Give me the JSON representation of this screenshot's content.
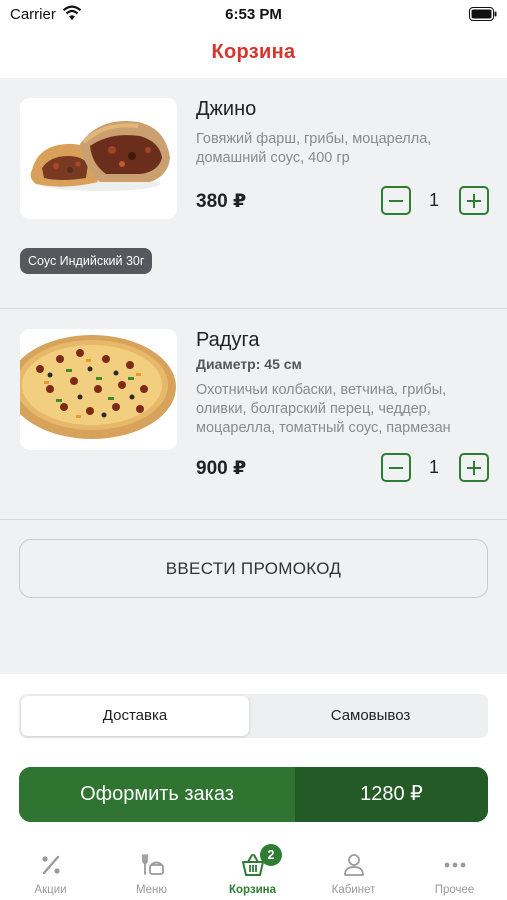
{
  "status_bar": {
    "carrier": "Carrier",
    "time": "6:53 PM"
  },
  "header": {
    "title": "Корзина"
  },
  "cart": {
    "items": [
      {
        "name": "Джино",
        "description": "Говяжий фарш, грибы, моцарелла, домашний соус, 400 гр",
        "price": "380 ₽",
        "quantity": "1",
        "addon": "Соус Индийский 30г"
      },
      {
        "name": "Радуга",
        "meta": "Диаметр: 45 см",
        "description": "Охотничьи колбаски, ветчина, грибы, оливки, болгарский перец, чеддер, моцарелла, томатный соус, пармезан",
        "price": "900 ₽",
        "quantity": "1"
      }
    ],
    "promo_label": "ВВЕСТИ ПРОМОКОД"
  },
  "delivery": {
    "options": [
      "Доставка",
      "Самовывоз"
    ],
    "selected": "Доставка"
  },
  "checkout": {
    "label": "Оформить заказ",
    "total": "1280 ₽"
  },
  "tabs": [
    {
      "label": "Акции",
      "icon": "percent-icon"
    },
    {
      "label": "Меню",
      "icon": "menu-icon"
    },
    {
      "label": "Корзина",
      "icon": "basket-icon",
      "badge": "2",
      "active": true
    },
    {
      "label": "Кабинет",
      "icon": "user-icon"
    },
    {
      "label": "Прочее",
      "icon": "more-icon"
    }
  ],
  "colors": {
    "accent": "#2e7d32",
    "title": "#d9342b",
    "background": "#f0f1f3"
  }
}
